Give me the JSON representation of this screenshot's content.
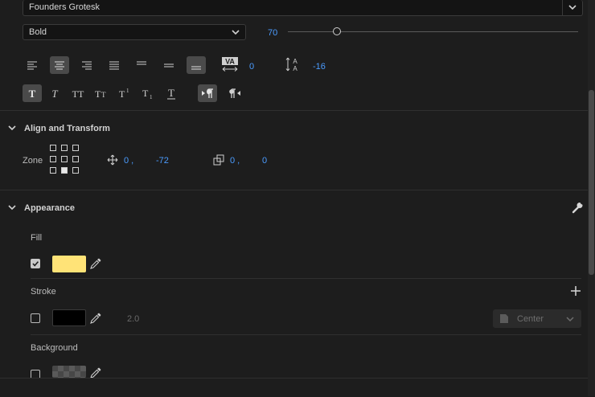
{
  "font": {
    "family": "Founders Grotesk",
    "style": "Bold",
    "size": "70",
    "size_slider_fraction": 0.17,
    "tracking": "0",
    "leading": "-16"
  },
  "align_transform": {
    "title": "Align and Transform",
    "zone_label": "Zone",
    "position_x": "0 ,",
    "position_y": "-72",
    "scale_x": "0 ,",
    "scale_y": "0"
  },
  "appearance": {
    "title": "Appearance",
    "fill_label": "Fill",
    "fill_checked": true,
    "fill_color": "#ffe377",
    "stroke_label": "Stroke",
    "stroke_checked": false,
    "stroke_color": "#000000",
    "stroke_width": "2.0",
    "stroke_position": "Center",
    "background_label": "Background",
    "background_checked": false
  },
  "colors": {
    "accent": "#4b9cff",
    "panel_bg": "#1d1d1d"
  }
}
